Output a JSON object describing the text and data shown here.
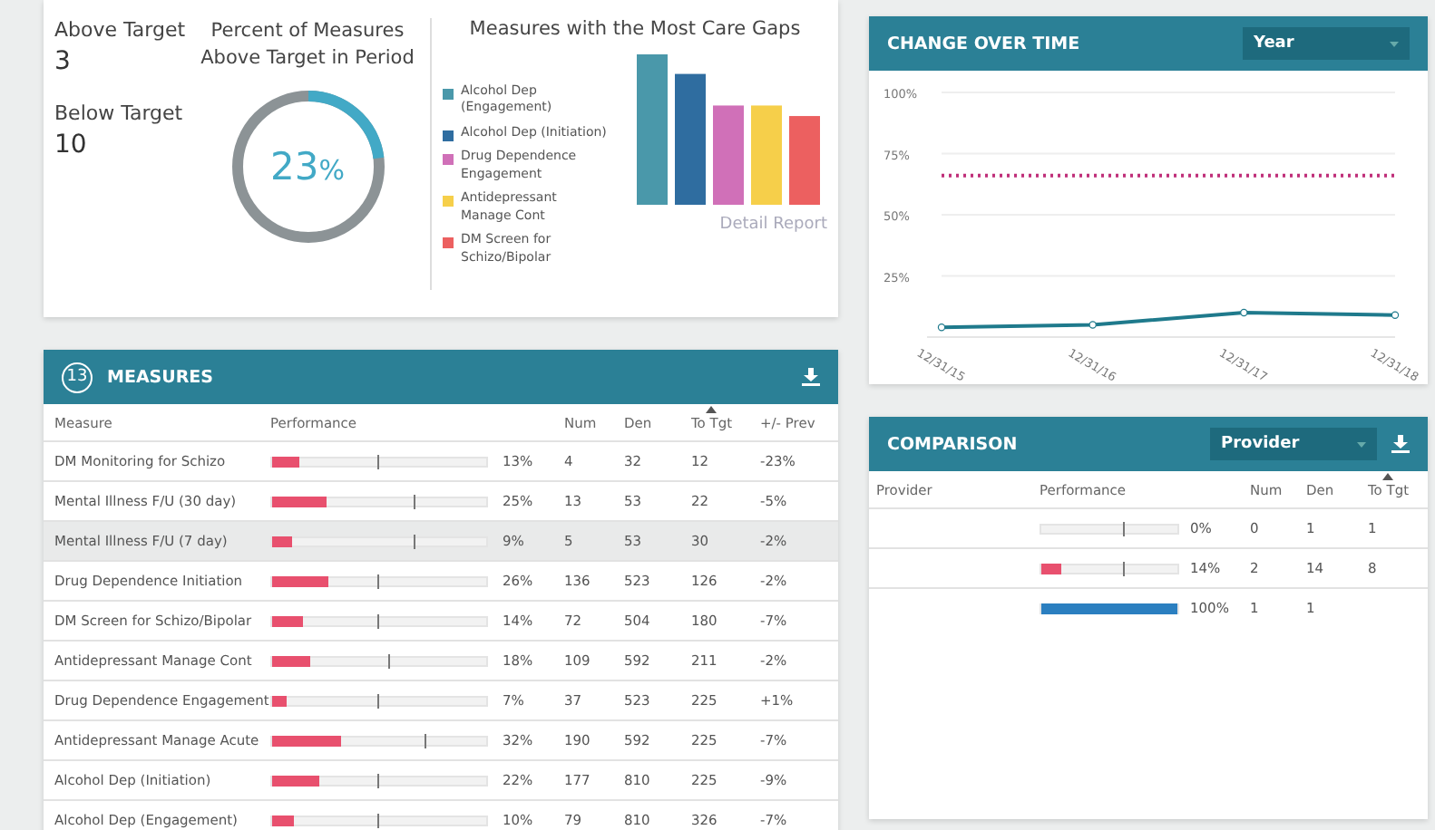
{
  "summary": {
    "stats": [
      {
        "label": "Above Target",
        "value": "3"
      },
      {
        "label": "Below Target",
        "value": "10"
      }
    ],
    "percent_above": {
      "title": "Percent of Measures Above Target in Period",
      "value": "23",
      "unit": "%"
    },
    "care_gaps": {
      "title": "Measures with the Most Care Gaps",
      "link": "Detail Report",
      "items": [
        {
          "label": "Alcohol Dep (Engagement)",
          "color": "#4a98aa"
        },
        {
          "label": "Alcohol Dep (Initiation)",
          "color": "#2f6da0"
        },
        {
          "label": "Drug Dependence Engagement",
          "color": "#d070b8"
        },
        {
          "label": "Antidepressant Manage Cont",
          "color": "#f6cf4a"
        },
        {
          "label": "DM Screen for Schizo/Bipolar",
          "color": "#ec6060"
        }
      ]
    }
  },
  "measures": {
    "count": "13",
    "title": "MEASURES",
    "columns": [
      {
        "label": "Measure",
        "sorted": false
      },
      {
        "label": "Performance",
        "sorted": false
      },
      {
        "label": "Num",
        "sorted": false
      },
      {
        "label": "Den",
        "sorted": false
      },
      {
        "label": "To Tgt",
        "sorted": true
      },
      {
        "label": "+/- Prev",
        "sorted": false
      }
    ],
    "rows": [
      {
        "measure": "DM Monitoring for Schizo",
        "level": 0.13,
        "target": {
          "level": 0.49
        },
        "percent": "13%",
        "num": "4",
        "den": "32",
        "to_tgt": "12",
        "prev": "-23%",
        "selected": false
      },
      {
        "measure": "Mental Illness F/U (30 day)",
        "level": 0.25,
        "target": {
          "level": 0.66
        },
        "percent": "25%",
        "num": "13",
        "den": "53",
        "to_tgt": "22",
        "prev": "-5%",
        "selected": false
      },
      {
        "measure": "Mental Illness F/U (7 day)",
        "level": 0.09,
        "target": {
          "level": 0.66
        },
        "percent": "9%",
        "num": "5",
        "den": "53",
        "to_tgt": "30",
        "prev": "-2%",
        "selected": true
      },
      {
        "measure": "Drug Dependence Initiation",
        "level": 0.26,
        "target": {
          "level": 0.49
        },
        "percent": "26%",
        "num": "136",
        "den": "523",
        "to_tgt": "126",
        "prev": "-2%",
        "selected": false
      },
      {
        "measure": "DM Screen for Schizo/Bipolar",
        "level": 0.14,
        "target": {
          "level": 0.49
        },
        "percent": "14%",
        "num": "72",
        "den": "504",
        "to_tgt": "180",
        "prev": "-7%",
        "selected": false
      },
      {
        "measure": "Antidepressant Manage Cont",
        "level": 0.18,
        "target": {
          "level": 0.54
        },
        "percent": "18%",
        "num": "109",
        "den": "592",
        "to_tgt": "211",
        "prev": "-2%",
        "selected": false
      },
      {
        "measure": "Drug Dependence Engagement",
        "level": 0.07,
        "target": {
          "level": 0.49
        },
        "percent": "7%",
        "num": "37",
        "den": "523",
        "to_tgt": "225",
        "prev": "+1%",
        "selected": false
      },
      {
        "measure": "Antidepressant Manage Acute",
        "level": 0.32,
        "target": {
          "level": 0.71
        },
        "percent": "32%",
        "num": "190",
        "den": "592",
        "to_tgt": "225",
        "prev": "-7%",
        "selected": false
      },
      {
        "measure": "Alcohol Dep (Initiation)",
        "level": 0.22,
        "target": {
          "level": 0.49
        },
        "percent": "22%",
        "num": "177",
        "den": "810",
        "to_tgt": "225",
        "prev": "-9%",
        "selected": false
      },
      {
        "measure": "Alcohol Dep (Engagement)",
        "level": 0.1,
        "target": {
          "level": 0.49
        },
        "percent": "10%",
        "num": "79",
        "den": "810",
        "to_tgt": "326",
        "prev": "-7%",
        "selected": false
      }
    ]
  },
  "change_over_time": {
    "title": "CHANGE OVER TIME",
    "period": "Year",
    "chart_data": {
      "type": "line",
      "grid": true,
      "categories": [
        "12/31/15",
        "12/31/16",
        "12/31/17",
        "12/31/18"
      ],
      "ylim": [
        0,
        100
      ],
      "yticks": [
        {
          "value": 25,
          "label": "25%"
        },
        {
          "value": 50,
          "label": "50%"
        },
        {
          "value": 75,
          "label": "75%"
        },
        {
          "value": 100,
          "label": "100%"
        }
      ],
      "series": [
        {
          "color": "#1f7a8c",
          "marker": "circle",
          "line_style": "solid",
          "values": [
            4,
            5,
            10,
            9
          ]
        },
        {
          "color": "#c0307a",
          "line_style": "dotted",
          "values": [
            66,
            66,
            66,
            66
          ]
        }
      ]
    }
  },
  "comparison": {
    "title": "COMPARISON",
    "group_by": "Provider",
    "columns": [
      {
        "label": "Provider",
        "sorted": false
      },
      {
        "label": "Performance",
        "sorted": false
      },
      {
        "label": "Num",
        "sorted": false
      },
      {
        "label": "Den",
        "sorted": false
      },
      {
        "label": "To Tgt",
        "sorted": true
      }
    ],
    "rows": [
      {
        "target": {
          "level": 0.6
        },
        "percent": "0%",
        "num": "0",
        "den": "1",
        "to_tgt": "1"
      },
      {
        "level": 0.14,
        "target": {
          "level": 0.6
        },
        "color": "#e8506e",
        "percent": "14%",
        "num": "2",
        "den": "14",
        "to_tgt": "8"
      },
      {
        "level": 1,
        "color": "#2b7fc0",
        "percent": "100%",
        "num": "1",
        "den": "1"
      }
    ]
  }
}
